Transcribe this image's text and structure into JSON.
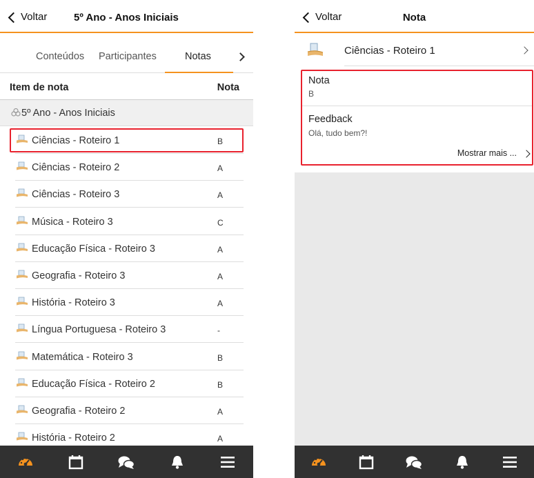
{
  "left": {
    "back_label": "Voltar",
    "title": "5º Ano - Anos Iniciais",
    "tabs": [
      {
        "label": "Conteúdos"
      },
      {
        "label": "Participantes"
      },
      {
        "label": "Notas"
      }
    ],
    "columns": {
      "item": "Item de nota",
      "grade": "Nota"
    },
    "course": "5º Ano - Anos Iniciais",
    "rows": [
      {
        "label": "Ciências - Roteiro 1",
        "grade": "B"
      },
      {
        "label": "Ciências - Roteiro 2",
        "grade": "A"
      },
      {
        "label": "Ciências - Roteiro 3",
        "grade": "A"
      },
      {
        "label": "Música - Roteiro 3",
        "grade": "C"
      },
      {
        "label": "Educação Física - Roteiro 3",
        "grade": "A"
      },
      {
        "label": "Geografia - Roteiro 3",
        "grade": "A"
      },
      {
        "label": "História - Roteiro 3",
        "grade": "A"
      },
      {
        "label": "Língua Portuguesa - Roteiro 3",
        "grade": "-"
      },
      {
        "label": "Matemática - Roteiro 3",
        "grade": "B"
      },
      {
        "label": "Educação Física - Roteiro 2",
        "grade": "B"
      },
      {
        "label": "Geografia - Roteiro 2",
        "grade": "A"
      },
      {
        "label": "História - Roteiro 2",
        "grade": "A"
      }
    ]
  },
  "right": {
    "back_label": "Voltar",
    "title": "Nota",
    "item_label": "Ciências - Roteiro 1",
    "grade_title": "Nota",
    "grade_value": "B",
    "feedback_title": "Feedback",
    "feedback_value": "Olá, tudo bem?!",
    "show_more": "Mostrar mais ..."
  },
  "tabbar": [
    {
      "icon": "dashboard-icon",
      "active": true
    },
    {
      "icon": "calendar-icon",
      "active": false
    },
    {
      "icon": "messages-icon",
      "active": false
    },
    {
      "icon": "bell-icon",
      "active": false
    },
    {
      "icon": "menu-icon",
      "active": false
    }
  ],
  "colors": {
    "accent": "#f5921e",
    "highlight": "#e8212d",
    "tabbar_bg": "#313131"
  }
}
